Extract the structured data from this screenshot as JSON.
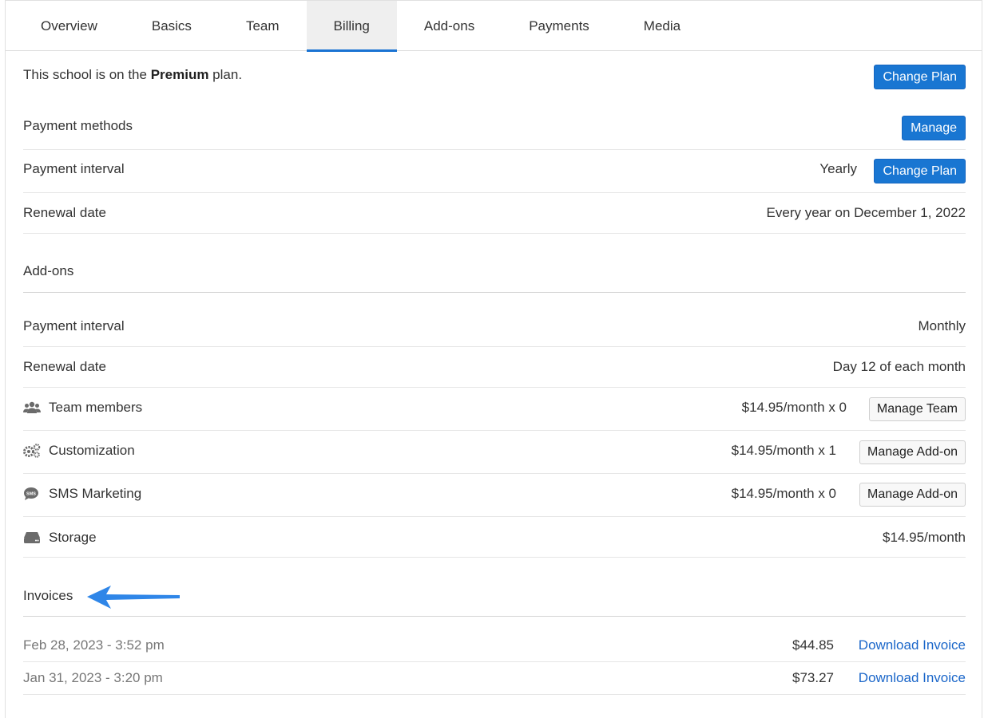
{
  "tabs": [
    {
      "label": "Overview",
      "active": false
    },
    {
      "label": "Basics",
      "active": false
    },
    {
      "label": "Team",
      "active": false
    },
    {
      "label": "Billing",
      "active": true
    },
    {
      "label": "Add-ons",
      "active": false
    },
    {
      "label": "Payments",
      "active": false
    },
    {
      "label": "Media",
      "active": false
    }
  ],
  "plan": {
    "prefix": "This school is on the ",
    "name": "Premium",
    "suffix": " plan.",
    "change_plan_label": "Change Plan"
  },
  "subscription": {
    "payment_methods_label": "Payment methods",
    "manage_label": "Manage",
    "payment_interval_label": "Payment interval",
    "payment_interval_value": "Yearly",
    "change_plan_label": "Change Plan",
    "renewal_date_label": "Renewal date",
    "renewal_date_value": "Every year on December 1, 2022"
  },
  "addons": {
    "title": "Add-ons",
    "payment_interval_label": "Payment interval",
    "payment_interval_value": "Monthly",
    "renewal_date_label": "Renewal date",
    "renewal_date_value": "Day 12 of each month",
    "items": [
      {
        "icon": "users-icon",
        "label": "Team members",
        "price": "$14.95/month x 0",
        "button": "Manage Team"
      },
      {
        "icon": "gears-icon",
        "label": "Customization",
        "price": "$14.95/month x 1",
        "button": "Manage Add-on"
      },
      {
        "icon": "sms-bubble-icon",
        "label": "SMS Marketing",
        "price": "$14.95/month x 0",
        "button": "Manage Add-on"
      },
      {
        "icon": "hard-drive-icon",
        "label": "Storage",
        "price": "$14.95/month",
        "button": ""
      }
    ]
  },
  "invoices": {
    "title": "Invoices",
    "items": [
      {
        "date": "Feb 28, 2023 - 3:52 pm",
        "amount": "$44.85",
        "link": "Download Invoice"
      },
      {
        "date": "Jan 31, 2023 - 3:20 pm",
        "amount": "$73.27",
        "link": "Download Invoice"
      }
    ]
  },
  "colors": {
    "primary": "#1976d2",
    "link": "#1a66c9",
    "arrow": "#2f86e8"
  }
}
